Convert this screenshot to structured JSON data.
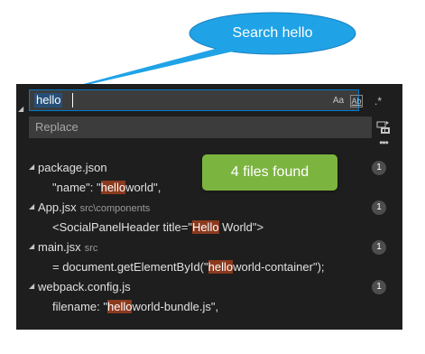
{
  "callout": {
    "text": "Search hello",
    "color": "#1fa3e6"
  },
  "search": {
    "query": "hello",
    "options": {
      "match_case": "Aa",
      "whole_word": "Ab",
      "regex": ".*"
    },
    "accent": "#007acc"
  },
  "replace": {
    "placeholder": "Replace"
  },
  "icons": {
    "collapse": "chevron-down-icon",
    "replace_all": "replace-all-icon",
    "more": "ellipsis-icon"
  },
  "results": [
    {
      "file": "package.json",
      "path": "",
      "count": "1",
      "match": {
        "before": "\"name\": \"",
        "hit": "hello",
        "after": "world\","
      }
    },
    {
      "file": "App.jsx",
      "path": "src\\components",
      "count": "1",
      "match": {
        "before": "<SocialPanelHeader title=\"",
        "hit": "Hello",
        "after": " World\">"
      }
    },
    {
      "file": "main.jsx",
      "path": "src",
      "count": "1",
      "match": {
        "before": "= document.getElementById(\"",
        "hit": "hello",
        "after": "world-container\");"
      }
    },
    {
      "file": "webpack.config.js",
      "path": "",
      "count": "1",
      "match": {
        "before": "filename: \"",
        "hit": "hello",
        "after": "world-bundle.js\","
      }
    }
  ],
  "toast": {
    "text": "4 files found",
    "color": "#7cb440"
  },
  "highlight_color": "#8b3a1e"
}
